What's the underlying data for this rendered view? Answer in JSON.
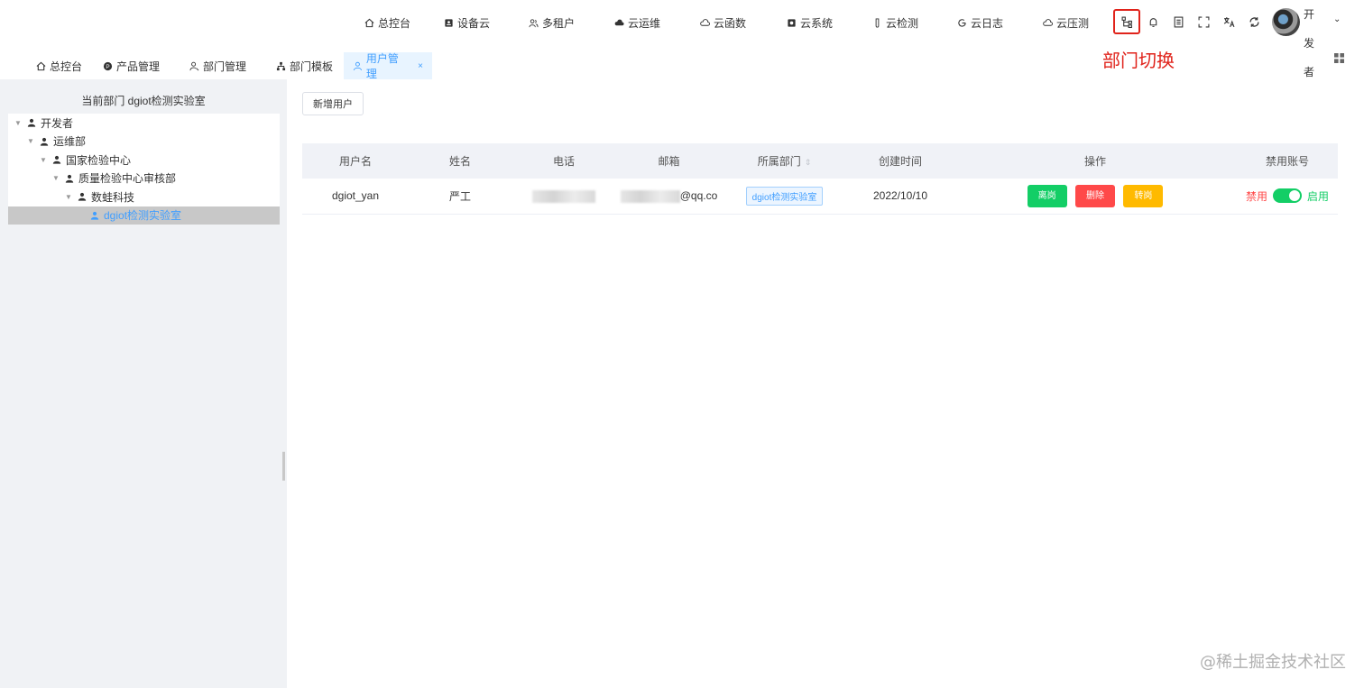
{
  "topnav": {
    "items": [
      {
        "label": "总控台",
        "icon": "home-icon"
      },
      {
        "label": "设备云",
        "icon": "device-icon"
      },
      {
        "label": "多租户",
        "icon": "users-icon"
      },
      {
        "label": "云运维",
        "icon": "cloud-icon"
      },
      {
        "label": "云函数",
        "icon": "cloud-outline-icon"
      },
      {
        "label": "云系统",
        "icon": "system-icon"
      },
      {
        "label": "云检测",
        "icon": "test-tube-icon"
      },
      {
        "label": "云日志",
        "icon": "refresh-log-icon"
      },
      {
        "label": "云压测",
        "icon": "cloud-pressure-icon"
      }
    ],
    "tools": [
      "department-switch-icon",
      "bell-icon",
      "document-icon",
      "fullscreen-icon",
      "translate-icon",
      "refresh-icon"
    ],
    "user_name": "开发者",
    "annotation": "部门切换"
  },
  "tabs": [
    {
      "label": "总控台",
      "icon": "home-icon"
    },
    {
      "label": "产品管理",
      "icon": "product-icon"
    },
    {
      "label": "部门管理",
      "icon": "user-edit-icon"
    },
    {
      "label": "部门模板",
      "icon": "org-icon"
    },
    {
      "label": "用户管理",
      "icon": "user-icon",
      "active": true,
      "close": "×"
    }
  ],
  "sidebar": {
    "title": "当前部门 dgiot检测实验室",
    "tree": [
      {
        "label": "开发者",
        "level": 0
      },
      {
        "label": "运维部",
        "level": 1
      },
      {
        "label": "国家检验中心",
        "level": 2
      },
      {
        "label": "质量检验中心审核部",
        "level": 3
      },
      {
        "label": "数蛙科技",
        "level": 4
      },
      {
        "label": "dgiot检测实验室",
        "level": 5,
        "selected": true
      }
    ]
  },
  "main": {
    "add_button": "新增用户",
    "columns": [
      "用户名",
      "姓名",
      "电话",
      "邮箱",
      "所属部门",
      "创建时间",
      "操作",
      "禁用账号"
    ],
    "rows": [
      {
        "username": "dgiot_yan",
        "name": "严工",
        "email_suffix": "@qq.co",
        "department": "dgiot检测实验室",
        "created": "2022/10/10",
        "actions": [
          "离岗",
          "删除",
          "转岗"
        ],
        "disable_label": "禁用",
        "enable_label": "启用"
      }
    ]
  },
  "watermark": "@稀土掘金技术社区",
  "colors": {
    "primary": "#409eff",
    "success": "#13ce66",
    "danger": "#ff4949",
    "warning": "#ffba00",
    "highlight": "#e0231b"
  }
}
